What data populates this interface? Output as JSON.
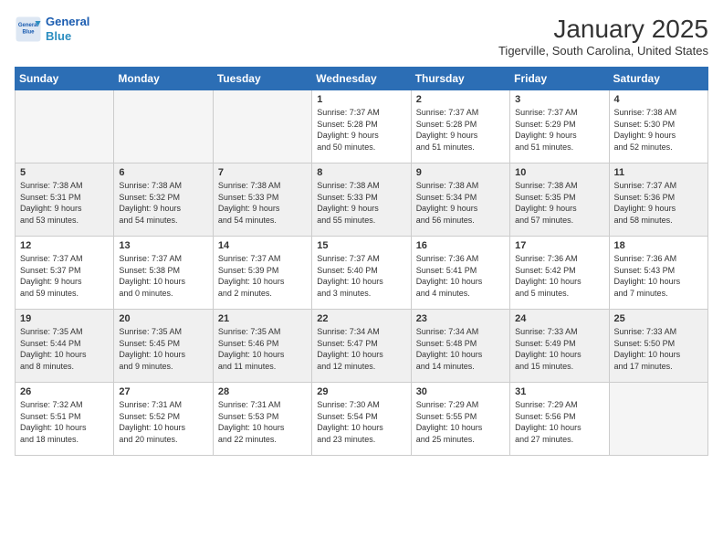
{
  "header": {
    "logo_line1": "General",
    "logo_line2": "Blue",
    "month_title": "January 2025",
    "location": "Tigerville, South Carolina, United States"
  },
  "days_of_week": [
    "Sunday",
    "Monday",
    "Tuesday",
    "Wednesday",
    "Thursday",
    "Friday",
    "Saturday"
  ],
  "weeks": [
    [
      {
        "day": "",
        "text": "",
        "empty": true
      },
      {
        "day": "",
        "text": "",
        "empty": true
      },
      {
        "day": "",
        "text": "",
        "empty": true
      },
      {
        "day": "1",
        "text": "Sunrise: 7:37 AM\nSunset: 5:28 PM\nDaylight: 9 hours\nand 50 minutes."
      },
      {
        "day": "2",
        "text": "Sunrise: 7:37 AM\nSunset: 5:28 PM\nDaylight: 9 hours\nand 51 minutes."
      },
      {
        "day": "3",
        "text": "Sunrise: 7:37 AM\nSunset: 5:29 PM\nDaylight: 9 hours\nand 51 minutes."
      },
      {
        "day": "4",
        "text": "Sunrise: 7:38 AM\nSunset: 5:30 PM\nDaylight: 9 hours\nand 52 minutes."
      }
    ],
    [
      {
        "day": "5",
        "text": "Sunrise: 7:38 AM\nSunset: 5:31 PM\nDaylight: 9 hours\nand 53 minutes."
      },
      {
        "day": "6",
        "text": "Sunrise: 7:38 AM\nSunset: 5:32 PM\nDaylight: 9 hours\nand 54 minutes."
      },
      {
        "day": "7",
        "text": "Sunrise: 7:38 AM\nSunset: 5:33 PM\nDaylight: 9 hours\nand 54 minutes."
      },
      {
        "day": "8",
        "text": "Sunrise: 7:38 AM\nSunset: 5:33 PM\nDaylight: 9 hours\nand 55 minutes."
      },
      {
        "day": "9",
        "text": "Sunrise: 7:38 AM\nSunset: 5:34 PM\nDaylight: 9 hours\nand 56 minutes."
      },
      {
        "day": "10",
        "text": "Sunrise: 7:38 AM\nSunset: 5:35 PM\nDaylight: 9 hours\nand 57 minutes."
      },
      {
        "day": "11",
        "text": "Sunrise: 7:37 AM\nSunset: 5:36 PM\nDaylight: 9 hours\nand 58 minutes."
      }
    ],
    [
      {
        "day": "12",
        "text": "Sunrise: 7:37 AM\nSunset: 5:37 PM\nDaylight: 9 hours\nand 59 minutes."
      },
      {
        "day": "13",
        "text": "Sunrise: 7:37 AM\nSunset: 5:38 PM\nDaylight: 10 hours\nand 0 minutes."
      },
      {
        "day": "14",
        "text": "Sunrise: 7:37 AM\nSunset: 5:39 PM\nDaylight: 10 hours\nand 2 minutes."
      },
      {
        "day": "15",
        "text": "Sunrise: 7:37 AM\nSunset: 5:40 PM\nDaylight: 10 hours\nand 3 minutes."
      },
      {
        "day": "16",
        "text": "Sunrise: 7:36 AM\nSunset: 5:41 PM\nDaylight: 10 hours\nand 4 minutes."
      },
      {
        "day": "17",
        "text": "Sunrise: 7:36 AM\nSunset: 5:42 PM\nDaylight: 10 hours\nand 5 minutes."
      },
      {
        "day": "18",
        "text": "Sunrise: 7:36 AM\nSunset: 5:43 PM\nDaylight: 10 hours\nand 7 minutes."
      }
    ],
    [
      {
        "day": "19",
        "text": "Sunrise: 7:35 AM\nSunset: 5:44 PM\nDaylight: 10 hours\nand 8 minutes."
      },
      {
        "day": "20",
        "text": "Sunrise: 7:35 AM\nSunset: 5:45 PM\nDaylight: 10 hours\nand 9 minutes."
      },
      {
        "day": "21",
        "text": "Sunrise: 7:35 AM\nSunset: 5:46 PM\nDaylight: 10 hours\nand 11 minutes."
      },
      {
        "day": "22",
        "text": "Sunrise: 7:34 AM\nSunset: 5:47 PM\nDaylight: 10 hours\nand 12 minutes."
      },
      {
        "day": "23",
        "text": "Sunrise: 7:34 AM\nSunset: 5:48 PM\nDaylight: 10 hours\nand 14 minutes."
      },
      {
        "day": "24",
        "text": "Sunrise: 7:33 AM\nSunset: 5:49 PM\nDaylight: 10 hours\nand 15 minutes."
      },
      {
        "day": "25",
        "text": "Sunrise: 7:33 AM\nSunset: 5:50 PM\nDaylight: 10 hours\nand 17 minutes."
      }
    ],
    [
      {
        "day": "26",
        "text": "Sunrise: 7:32 AM\nSunset: 5:51 PM\nDaylight: 10 hours\nand 18 minutes."
      },
      {
        "day": "27",
        "text": "Sunrise: 7:31 AM\nSunset: 5:52 PM\nDaylight: 10 hours\nand 20 minutes."
      },
      {
        "day": "28",
        "text": "Sunrise: 7:31 AM\nSunset: 5:53 PM\nDaylight: 10 hours\nand 22 minutes."
      },
      {
        "day": "29",
        "text": "Sunrise: 7:30 AM\nSunset: 5:54 PM\nDaylight: 10 hours\nand 23 minutes."
      },
      {
        "day": "30",
        "text": "Sunrise: 7:29 AM\nSunset: 5:55 PM\nDaylight: 10 hours\nand 25 minutes."
      },
      {
        "day": "31",
        "text": "Sunrise: 7:29 AM\nSunset: 5:56 PM\nDaylight: 10 hours\nand 27 minutes."
      },
      {
        "day": "",
        "text": "",
        "empty": true
      }
    ]
  ]
}
